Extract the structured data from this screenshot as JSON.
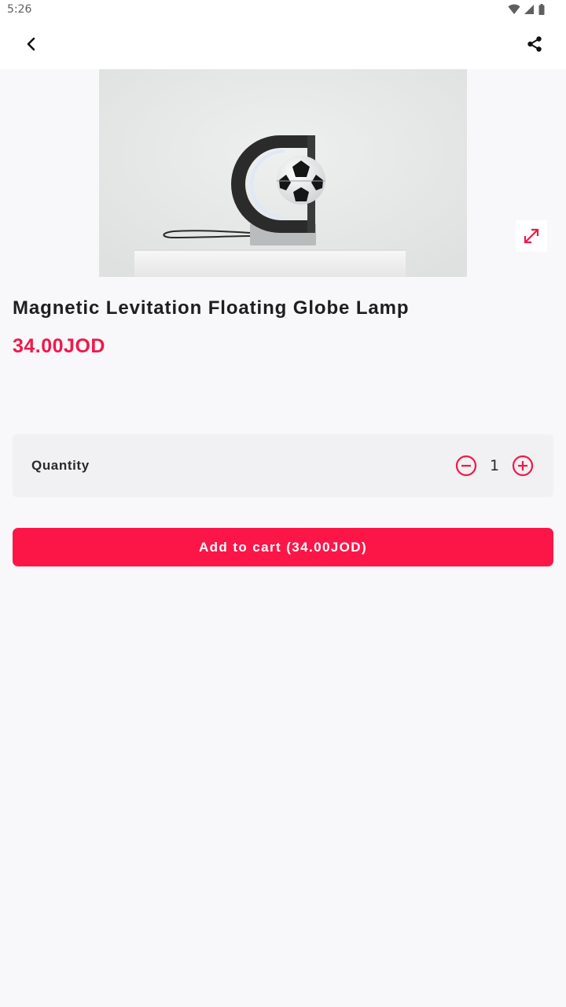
{
  "status_bar": {
    "time": "5:26",
    "icons": [
      "wifi-icon",
      "cell-signal-icon",
      "battery-icon"
    ]
  },
  "app_bar": {
    "back_icon": "chevron-left-icon",
    "share_icon": "share-icon"
  },
  "product": {
    "image_alt": "Magnetic Levitation Floating Globe Lamp",
    "expand_icon": "expand-icon",
    "title": "Magnetic Levitation Floating Globe Lamp",
    "price": "34.00JOD"
  },
  "quantity": {
    "label": "Quantity",
    "value": "1",
    "minus_icon": "minus-circle-icon",
    "plus_icon": "plus-circle-icon"
  },
  "cart": {
    "button_label": "Add to cart (34.00JOD)"
  },
  "colors": {
    "accent": "#fc1648",
    "price": "#f0184a",
    "background": "#f8f7f9",
    "panel": "#f1f0f2"
  }
}
